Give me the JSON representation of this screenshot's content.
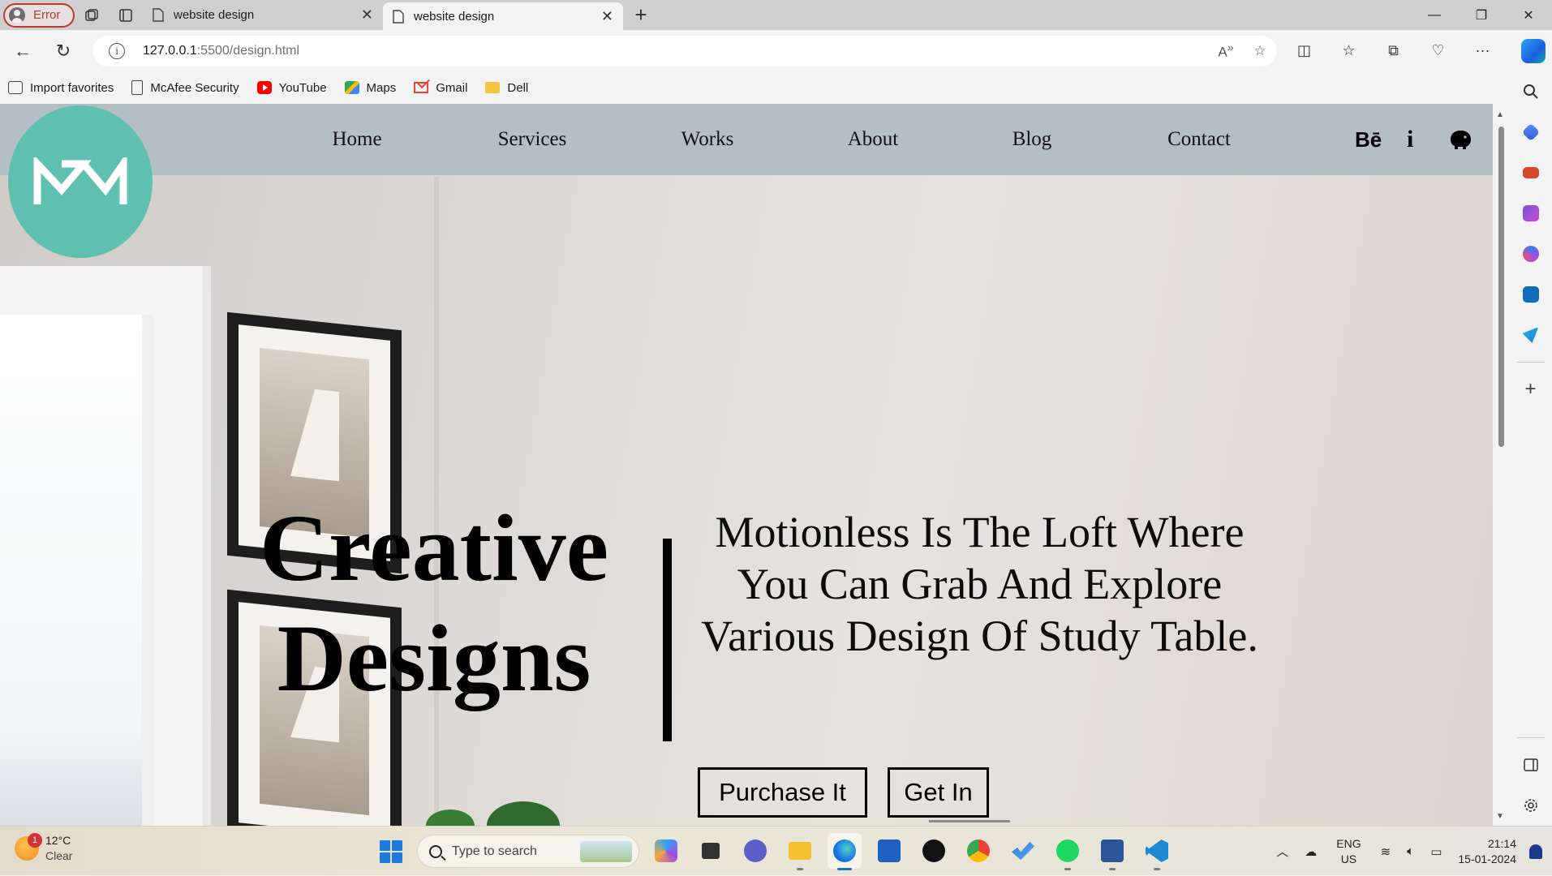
{
  "browser": {
    "profile_label": "Error",
    "tabs": [
      {
        "title": "website design",
        "active": false
      },
      {
        "title": "website design",
        "active": true
      }
    ],
    "new_tab": "+",
    "window_controls": {
      "minimize": "—",
      "maximize": "❐",
      "close": "✕"
    },
    "url_host": "127.0.0.1",
    "url_path": ":5500/design.html",
    "favorites": [
      {
        "label": "Import favorites",
        "icon": "import-icon"
      },
      {
        "label": "McAfee Security",
        "icon": "page-icon"
      },
      {
        "label": "YouTube",
        "icon": "youtube-icon"
      },
      {
        "label": "Maps",
        "icon": "maps-icon"
      },
      {
        "label": "Gmail",
        "icon": "gmail-icon"
      },
      {
        "label": "Dell",
        "icon": "folder-icon"
      }
    ]
  },
  "site": {
    "logo_text": "M",
    "nav": [
      "Home",
      "Services",
      "Works",
      "About",
      "Blog",
      "Contact"
    ],
    "social": {
      "behance": "Bē",
      "info": "i"
    },
    "hero_title_line1": "Creative",
    "hero_title_line2": "Designs",
    "hero_text": "Motionless Is The Loft Where You Can Grab And Explore Various Design Of Study Table.",
    "buttons": {
      "purchase": "Purchase It",
      "get_in": "Get In"
    },
    "colors": {
      "header_bg": "#b4bfc5",
      "logo_bg": "#5fc0b0"
    }
  },
  "taskbar": {
    "weather_temp": "12°C",
    "weather_cond": "Clear",
    "weather_badge": "1",
    "search_placeholder": "Type to search",
    "lang_top": "ENG",
    "lang_bottom": "US",
    "time": "21:14",
    "date": "15-01-2024"
  }
}
